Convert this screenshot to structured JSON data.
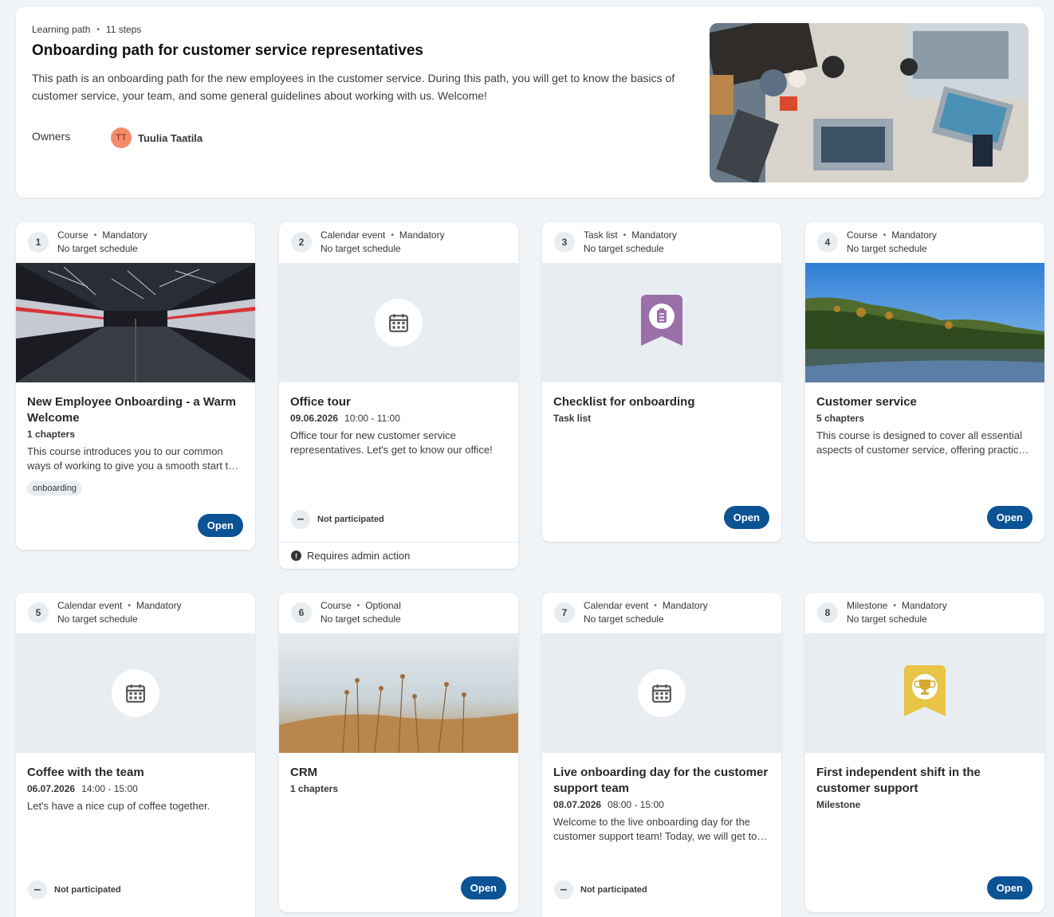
{
  "path": {
    "type": "Learning path",
    "steps": "11 steps",
    "title": "Onboarding path for customer service representatives",
    "description": "This path is an onboarding path for the new employees in the customer service. During this path, you will get to know the basics of customer service, your team, and some general guidelines about working with us. Welcome!",
    "owners_label": "Owners",
    "owner_initials": "TT",
    "owner_name": "Tuulia Taatila"
  },
  "cards": [
    {
      "num": "1",
      "type": "Course",
      "req": "Mandatory",
      "schedule": "No target schedule",
      "title": "New Employee Onboarding - a Warm Welcome",
      "sub": "1 chapters",
      "desc": "This course introduces you to our common ways of working to give you a smooth start to your new job.",
      "tag": "onboarding",
      "action": "Open"
    },
    {
      "num": "2",
      "type": "Calendar event",
      "req": "Mandatory",
      "schedule": "No target schedule",
      "title": "Office tour",
      "date": "09.06.2026",
      "time": "10:00 - 11:00",
      "desc": "Office tour for new customer service representatives. Let's get to know our office!",
      "participation": "Not participated",
      "admin": "Requires admin action"
    },
    {
      "num": "3",
      "type": "Task list",
      "req": "Mandatory",
      "schedule": "No target schedule",
      "title": "Checklist for onboarding",
      "sub": "Task list",
      "action": "Open"
    },
    {
      "num": "4",
      "type": "Course",
      "req": "Mandatory",
      "schedule": "No target schedule",
      "title": "Customer service",
      "sub": "5 chapters",
      "desc": "This course is designed to cover all essential aspects of customer service, offering practical tips and examples.",
      "action": "Open"
    },
    {
      "num": "5",
      "type": "Calendar event",
      "req": "Mandatory",
      "schedule": "No target schedule",
      "title": "Coffee with the team",
      "date": "06.07.2026",
      "time": "14:00 - 15:00",
      "desc": "Let's have a nice cup of coffee together.",
      "participation": "Not participated"
    },
    {
      "num": "6",
      "type": "Course",
      "req": "Optional",
      "schedule": "No target schedule",
      "title": "CRM",
      "sub": "1 chapters",
      "action": "Open"
    },
    {
      "num": "7",
      "type": "Calendar event",
      "req": "Mandatory",
      "schedule": "No target schedule",
      "title": "Live onboarding day for the customer support team",
      "date": "08.07.2026",
      "time": "08:00 - 15:00",
      "desc": "Welcome to the live onboarding day for the customer support team! Today, we will get to know each other.",
      "participation": "Not participated"
    },
    {
      "num": "8",
      "type": "Milestone",
      "req": "Mandatory",
      "schedule": "No target schedule",
      "title": "First independent shift in the customer support",
      "sub": "Milestone",
      "action": "Open"
    }
  ],
  "colors": {
    "primary_button": "#0b5394",
    "tasklist_badge": "#9b6fa8",
    "milestone_badge": "#e8c544",
    "avatar": "#f48b6b"
  },
  "icons": {
    "calendar": "calendar-icon",
    "tasklist": "clipboard-icon",
    "milestone": "trophy-icon",
    "alert": "alert-icon"
  }
}
